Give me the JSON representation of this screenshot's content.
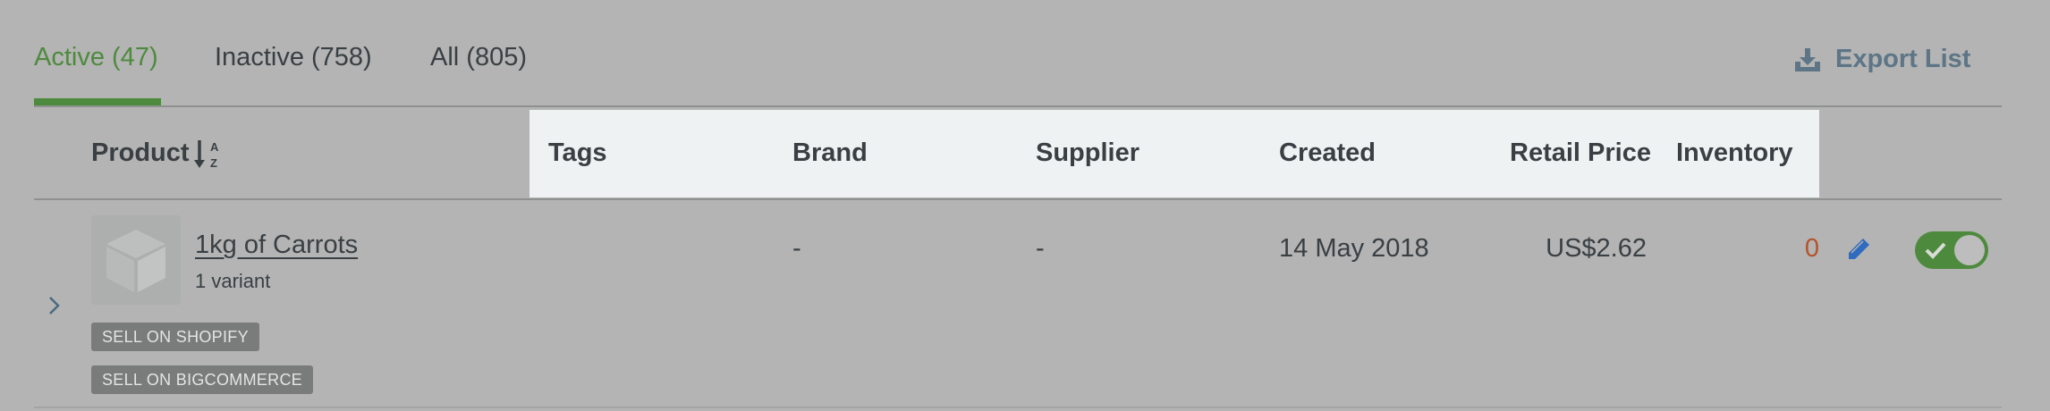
{
  "tabs": [
    {
      "label": "Active (47)",
      "active": true
    },
    {
      "label": "Inactive (758)",
      "active": false
    },
    {
      "label": "All (805)",
      "active": false
    }
  ],
  "export": {
    "label": "Export List",
    "icon": "download-icon"
  },
  "columns": {
    "product": "Product",
    "tags": "Tags",
    "brand": "Brand",
    "supplier": "Supplier",
    "created": "Created",
    "retail_price": "Retail Price",
    "inventory": "Inventory"
  },
  "sort_icon": {
    "name": "sort-alpha-icon",
    "top": "A",
    "bottom": "Z"
  },
  "rows": [
    {
      "name": "1kg of Carrots",
      "variants": "1 variant",
      "badges": [
        "SELL ON SHOPIFY",
        "SELL ON BIGCOMMERCE"
      ],
      "brand": "-",
      "supplier": "-",
      "created": "14 May 2018",
      "retail_price": "US$2.62",
      "inventory": "0",
      "active": true
    }
  ],
  "colors": {
    "accent": "#4e8a3e",
    "header_band": "#eef2f3",
    "inventory_zero": "#b5532d",
    "export": "#5d7587",
    "edit_icon": "#2f6bbf"
  }
}
